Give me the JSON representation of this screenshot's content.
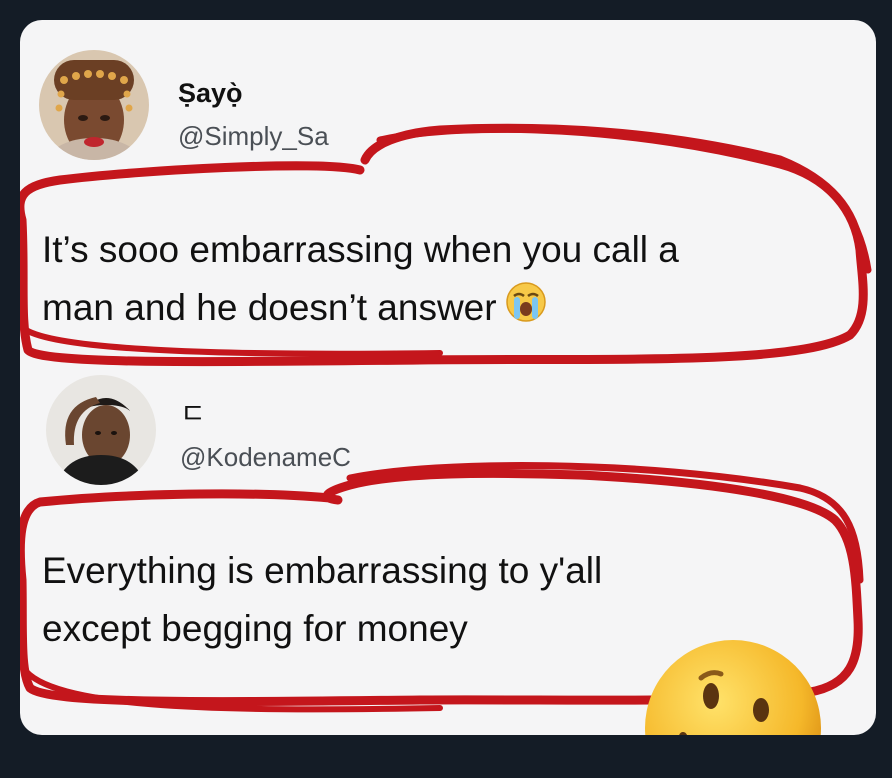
{
  "tweets": [
    {
      "name": "Ṣayọ̀",
      "handle": "@Simply_Sa",
      "text_lines": [
        "It’s sooo embarrassing when you call a",
        "man and he doesn’t answer"
      ],
      "emoji": "loudly-crying-face-icon"
    },
    {
      "name": "ㄷ",
      "handle": "@KodenameC",
      "text_lines": [
        "Everything is embarrassing to y'all",
        "except begging for money"
      ],
      "emoji": "smirking-face-icon"
    }
  ],
  "colors": {
    "background": "#141c26",
    "card": "#f5f5f6",
    "scribble": "#c4161c",
    "text": "#111111",
    "handle": "#4a4f55"
  }
}
